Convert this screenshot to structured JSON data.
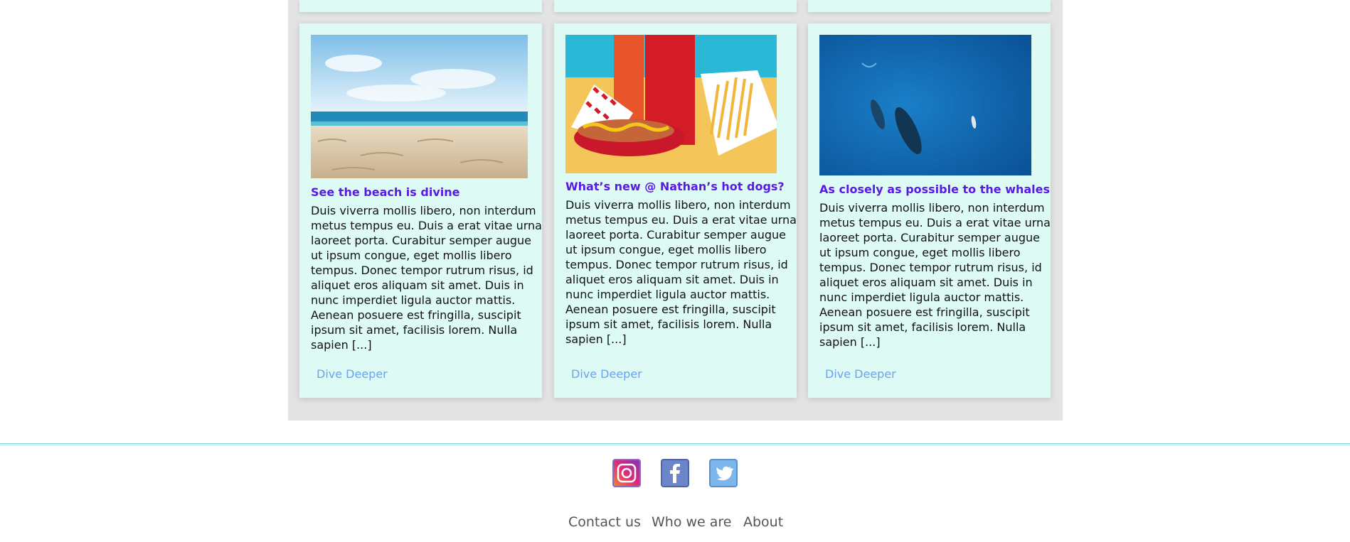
{
  "cards": [
    {
      "title": "See the beach is divine",
      "text": "Duis viverra mollis libero, non interdum\nmetus tempus eu. Duis a erat vitae urna\nlaoreet porta. Curabitur semper augue\nut ipsum congue, eget mollis libero\ntempus. Donec tempor rutrum risus, id\naliquet eros aliquam sit amet. Duis in\nnunc imperdiet ligula auctor mattis.\nAenean posuere est fringilla, suscipit\nipsum sit amet, facilisis lorem. Nulla\nsapien [...]",
      "link": "Dive Deeper"
    },
    {
      "title": "What’s new @ Nathan’s hot dogs?",
      "text": "Duis viverra mollis libero, non interdum\nmetus tempus eu. Duis a erat vitae urna\nlaoreet porta. Curabitur semper augue\nut ipsum congue, eget mollis libero\ntempus. Donec tempor rutrum risus, id\naliquet eros aliquam sit amet. Duis in\nnunc imperdiet ligula auctor mattis.\nAenean posuere est fringilla, suscipit\nipsum sit amet, facilisis lorem. Nulla\nsapien [...]",
      "link": "Dive Deeper"
    },
    {
      "title": "As closely as possible to the whales",
      "text": "Duis viverra mollis libero, non interdum\nmetus tempus eu. Duis a erat vitae urna\nlaoreet porta. Curabitur semper augue\nut ipsum congue, eget mollis libero\ntempus. Donec tempor rutrum risus, id\naliquet eros aliquam sit amet. Duis in\nnunc imperdiet ligula auctor mattis.\nAenean posuere est fringilla, suscipit\nipsum sit amet, facilisis lorem. Nulla\nsapien [...]",
      "link": "Dive Deeper"
    }
  ],
  "footer": {
    "social": [
      "instagram-icon",
      "facebook-icon",
      "twitter-icon"
    ],
    "nav": [
      "Contact us",
      "Who we are",
      "About"
    ]
  },
  "colors": {
    "panel_bg": "#e3e3e3",
    "card_bg": "#defaf4",
    "title": "#5a1ae6",
    "link": "#6aa4ee",
    "footer_line": "#7fd4dc"
  }
}
